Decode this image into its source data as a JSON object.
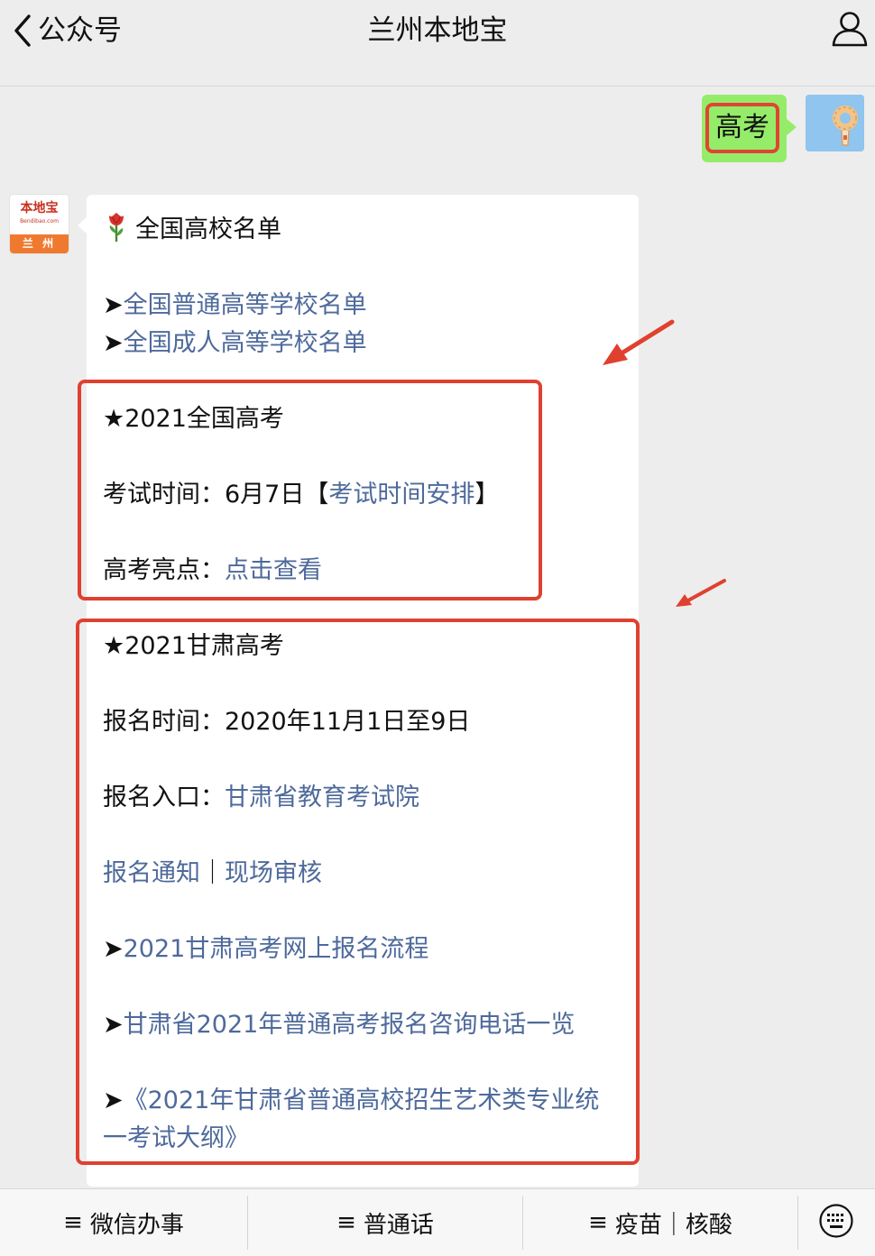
{
  "header": {
    "back_label": "公众号",
    "title": "兰州本地宝"
  },
  "user_message": {
    "text": "高考"
  },
  "bot_avatar": {
    "name": "本地宝",
    "sub": "Bendibao.com",
    "city": "兰 州"
  },
  "bot_message": {
    "heading": "全国高校名单",
    "school_links": [
      {
        "prefix": "➤",
        "label": "全国普通高等学校名单"
      },
      {
        "prefix": "➤",
        "label": "全国成人高等学校名单"
      }
    ],
    "national": {
      "title": "★2021全国高考",
      "exam_time_label": "考试时间：6月7日【",
      "exam_time_link": "考试时间安排",
      "exam_time_close": "】",
      "highlight_label": "高考亮点：",
      "highlight_link": "点击查看"
    },
    "gansu": {
      "title": "★2021甘肃高考",
      "signup_time": "报名时间：2020年11月1日至9日",
      "entry_label": "报名入口：",
      "entry_link": "甘肃省教育考试院",
      "notice_link": "报名通知",
      "sep": "｜",
      "review_link": "现场审核",
      "links": [
        {
          "prefix": "➤",
          "label": "2021甘肃高考网上报名流程"
        },
        {
          "prefix": "➤",
          "label": "甘肃省2021年普通高考报名咨询电话一览"
        }
      ],
      "outline_prefix": "➤",
      "outline_line1": "《2021年甘肃省普通高校招生艺术类专业统",
      "outline_line2": "一考试大纲》"
    }
  },
  "bottom_menu": [
    {
      "glyph": "≡",
      "label": "微信办事"
    },
    {
      "glyph": "≡",
      "label": "普通话"
    },
    {
      "glyph": "≡",
      "label": "疫苗｜核酸"
    }
  ],
  "colors": {
    "background": "#ededed",
    "user_bubble": "#95ec69",
    "link": "#4e6a9b",
    "annotation_red": "#e0412f"
  }
}
